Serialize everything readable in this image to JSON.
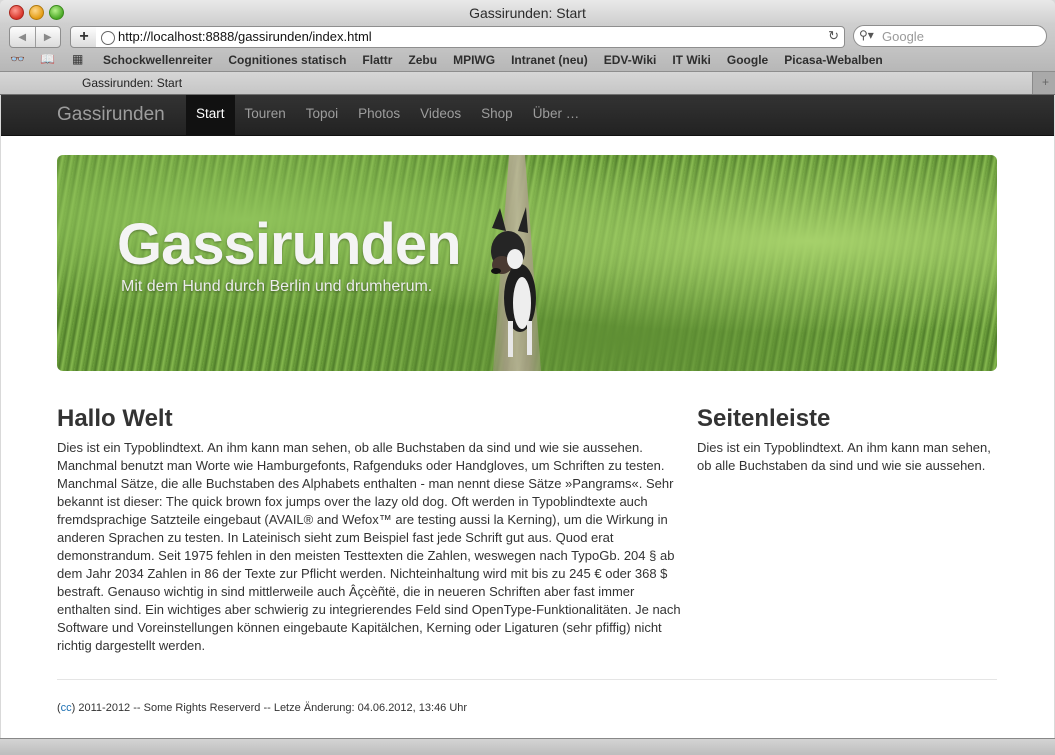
{
  "window": {
    "title": "Gassirunden: Start"
  },
  "toolbar": {
    "url": "http://localhost:8888/gassirunden/index.html",
    "search_placeholder": "Google",
    "add_label": "+"
  },
  "bookmarks": [
    "Schockwellenreiter",
    "Cognitiones statisch",
    "Flattr",
    "Zebu",
    "MPIWG",
    "Intranet (neu)",
    "EDV-Wiki",
    "IT Wiki",
    "Google",
    "Picasa-Webalben"
  ],
  "tab": {
    "label": "Gassirunden: Start"
  },
  "site": {
    "brand": "Gassirunden",
    "nav": [
      "Start",
      "Touren",
      "Topoi",
      "Photos",
      "Videos",
      "Shop",
      "Über …"
    ],
    "hero": {
      "title": "Gassirunden",
      "subtitle": "Mit dem Hund durch Berlin und drumherum."
    },
    "main": {
      "heading": "Hallo Welt",
      "text": "Dies ist ein Typoblindtext. An ihm kann man sehen, ob alle Buchstaben da sind und wie sie aussehen. Manchmal benutzt man Worte wie Hamburgefonts, Rafgenduks oder Handgloves, um Schriften zu testen. Manchmal Sätze, die alle Buchstaben des Alphabets enthalten - man nennt diese Sätze »Pangrams«. Sehr bekannt ist dieser: The quick brown fox jumps over the lazy old dog. Oft werden in Typoblindtexte auch fremdsprachige Satzteile eingebaut (AVAIL® and Wefox™ are testing aussi la Kerning), um die Wirkung in anderen Sprachen zu testen. In Lateinisch sieht zum Beispiel fast jede Schrift gut aus. Quod erat demonstrandum. Seit 1975 fehlen in den meisten Testtexten die Zahlen, weswegen nach TypoGb. 204 § ab dem Jahr 2034 Zahlen in 86 der Texte zur Pflicht werden. Nichteinhaltung wird mit bis zu 245 € oder 368 $ bestraft. Genauso wichtig in sind mittlerweile auch Âçcèñtë, die in neueren Schriften aber fast immer enthalten sind. Ein wichtiges aber schwierig zu integrierendes Feld sind OpenType-Funktionalitäten. Je nach Software und Voreinstellungen können eingebaute Kapitälchen, Kerning oder Ligaturen (sehr pfiffig) nicht richtig dargestellt werden."
    },
    "sidebar": {
      "heading": "Seitenleiste",
      "text": "Dies ist ein Typoblindtext. An ihm kann man sehen, ob alle Buchstaben da sind und wie sie aussehen."
    },
    "footer": {
      "cc": "cc",
      "text": ") 2011-2012 -- Some Rights Reserverd -- Letze Änderung: 04.06.2012, 13:46 Uhr",
      "open": "("
    }
  }
}
